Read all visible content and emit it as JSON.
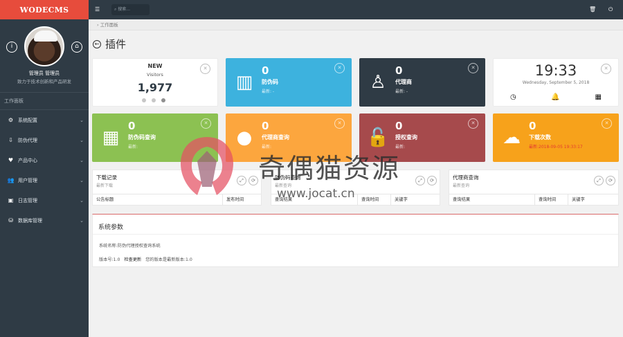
{
  "brand": "WODECMS",
  "profile": {
    "name": "管理员 管理员",
    "subtitle": "致力于技术创新和产品研发"
  },
  "section_title": "工作面板",
  "menu": [
    {
      "label": "系统配置",
      "icon": "gears-icon"
    },
    {
      "label": "防伪代理",
      "icon": "download-icon"
    },
    {
      "label": "产品中心",
      "icon": "heart-icon"
    },
    {
      "label": "用户管理",
      "icon": "users-icon"
    },
    {
      "label": "日志管理",
      "icon": "calculator-icon"
    },
    {
      "label": "数据库管理",
      "icon": "database-icon"
    }
  ],
  "top": {
    "search_placeholder": "搜索..."
  },
  "breadcrumb": "工作面板",
  "page_title": "插件",
  "cards": {
    "new": {
      "title": "NEW",
      "subtitle": "Visitors",
      "value": "1,977"
    },
    "anti_code": {
      "value": "0",
      "label": "防伪码",
      "meta": "最新: -"
    },
    "agent": {
      "value": "0",
      "label": "代理商",
      "meta": "最新: -"
    },
    "clock": {
      "time": "19:33",
      "date": "Wednesday, September 5, 2018"
    },
    "anti_query": {
      "value": "0",
      "label": "防伪码查询",
      "meta": "最新:"
    },
    "agent_query": {
      "value": "0",
      "label": "代理商查询",
      "meta": "最新:"
    },
    "auth_query": {
      "value": "0",
      "label": "授权查询",
      "meta": "最新:"
    },
    "downloads": {
      "value": "0",
      "label": "下载次数",
      "meta": "最新:2018-09-05 19:33:17"
    }
  },
  "panels": {
    "downloads": {
      "title": "下载记录",
      "subtitle": "最新下载",
      "columns": [
        "公告标题",
        "发布时间"
      ]
    },
    "anti": {
      "title": "防伪码查询",
      "subtitle": "最新查询",
      "columns": [
        "查询结果",
        "查询时间",
        "关键字"
      ]
    },
    "agent": {
      "title": "代理商查询",
      "subtitle": "最新查询",
      "columns": [
        "查询结果",
        "查询时间",
        "关键字"
      ]
    }
  },
  "system": {
    "title": "系统参数",
    "name_line": "系统名称:防伪代理授权查询系统",
    "version": "版本号:1.0",
    "check_update": "检查更新",
    "latest": "您的版本是最新版本:1.0"
  },
  "watermark": {
    "text": "奇偶猫资源",
    "url": "www.jocat.cn"
  },
  "colors": {
    "sidebar": "#2f3b45",
    "brand": "#e74c3c",
    "blue": "#3db2de",
    "green": "#8cc152",
    "orange": "#fca63e",
    "red": "#a64a4c",
    "gold": "#f7a21b"
  }
}
